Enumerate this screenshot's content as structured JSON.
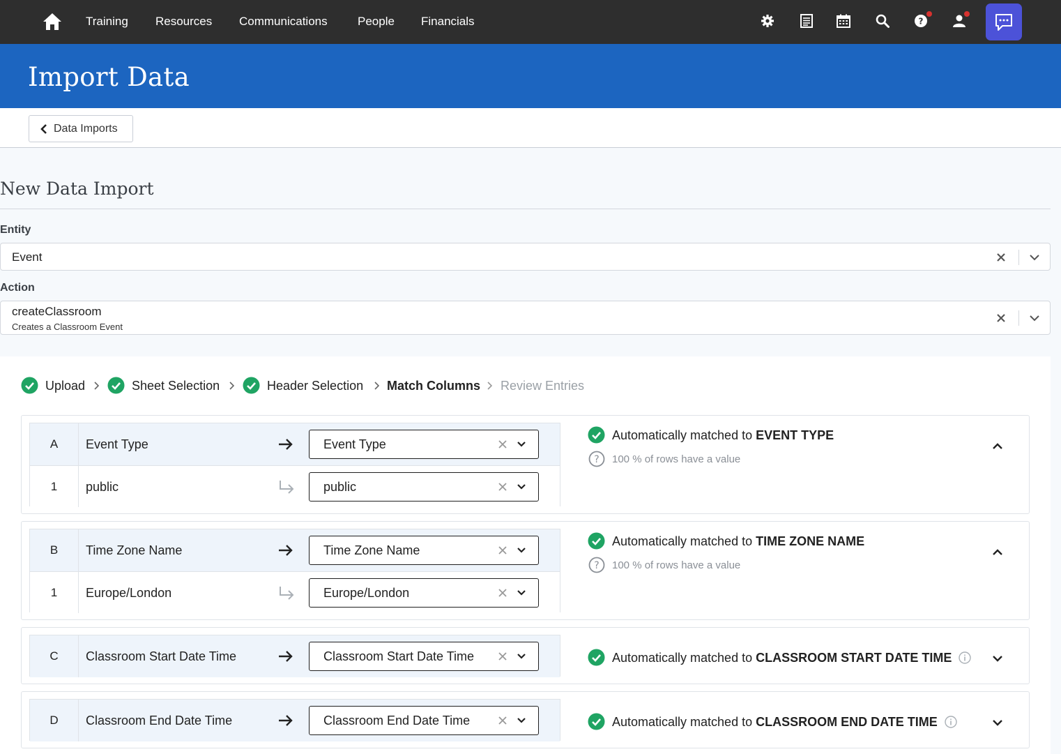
{
  "nav": {
    "links": [
      "Training",
      "Resources",
      "Communications",
      "People",
      "Financials"
    ],
    "icons": [
      "home-icon",
      "settings-icon",
      "list-icon",
      "calendar-icon",
      "search-icon",
      "help-icon",
      "user-icon",
      "chat-icon"
    ],
    "accent_chat": "#4c52d8",
    "notification_dot": "#d7322f"
  },
  "page": {
    "title": "Import Data",
    "back_label": "Data Imports",
    "section_title": "New Data Import",
    "banner_color": "#1c65c0"
  },
  "form": {
    "entity_label": "Entity",
    "entity_value": "Event",
    "action_label": "Action",
    "action_value": "createClassroom",
    "action_description": "Creates a Classroom Event"
  },
  "steps": [
    {
      "label": "Upload",
      "state": "done"
    },
    {
      "label": "Sheet Selection",
      "state": "done"
    },
    {
      "label": "Header Selection",
      "state": "done"
    },
    {
      "label": "Match Columns",
      "state": "current"
    },
    {
      "label": "Review Entries",
      "state": "pending"
    }
  ],
  "columns": [
    {
      "letter": "A",
      "name": "Event Type",
      "match": "Event Type",
      "sample_row": "1",
      "sample_value": "public",
      "sample_match": "public",
      "status_prefix": "Automatically matched to",
      "status_target": "EVENT TYPE",
      "coverage": "100 % of rows have a value",
      "expanded": true
    },
    {
      "letter": "B",
      "name": "Time Zone Name",
      "match": "Time Zone Name",
      "sample_row": "1",
      "sample_value": "Europe/London",
      "sample_match": "Europe/London",
      "status_prefix": "Automatically matched to",
      "status_target": "TIME ZONE NAME",
      "coverage": "100 % of rows have a value",
      "expanded": true
    },
    {
      "letter": "C",
      "name": "Classroom Start Date Time",
      "match": "Classroom Start Date Time",
      "status_prefix": "Automatically matched to",
      "status_target": "CLASSROOM START DATE TIME",
      "expanded": false
    },
    {
      "letter": "D",
      "name": "Classroom End Date Time",
      "match": "Classroom End Date Time",
      "status_prefix": "Automatically matched to",
      "status_target": "CLASSROOM END DATE TIME",
      "expanded": false
    }
  ],
  "colors": {
    "success": "#1fa463",
    "muted": "#8a8f96"
  }
}
